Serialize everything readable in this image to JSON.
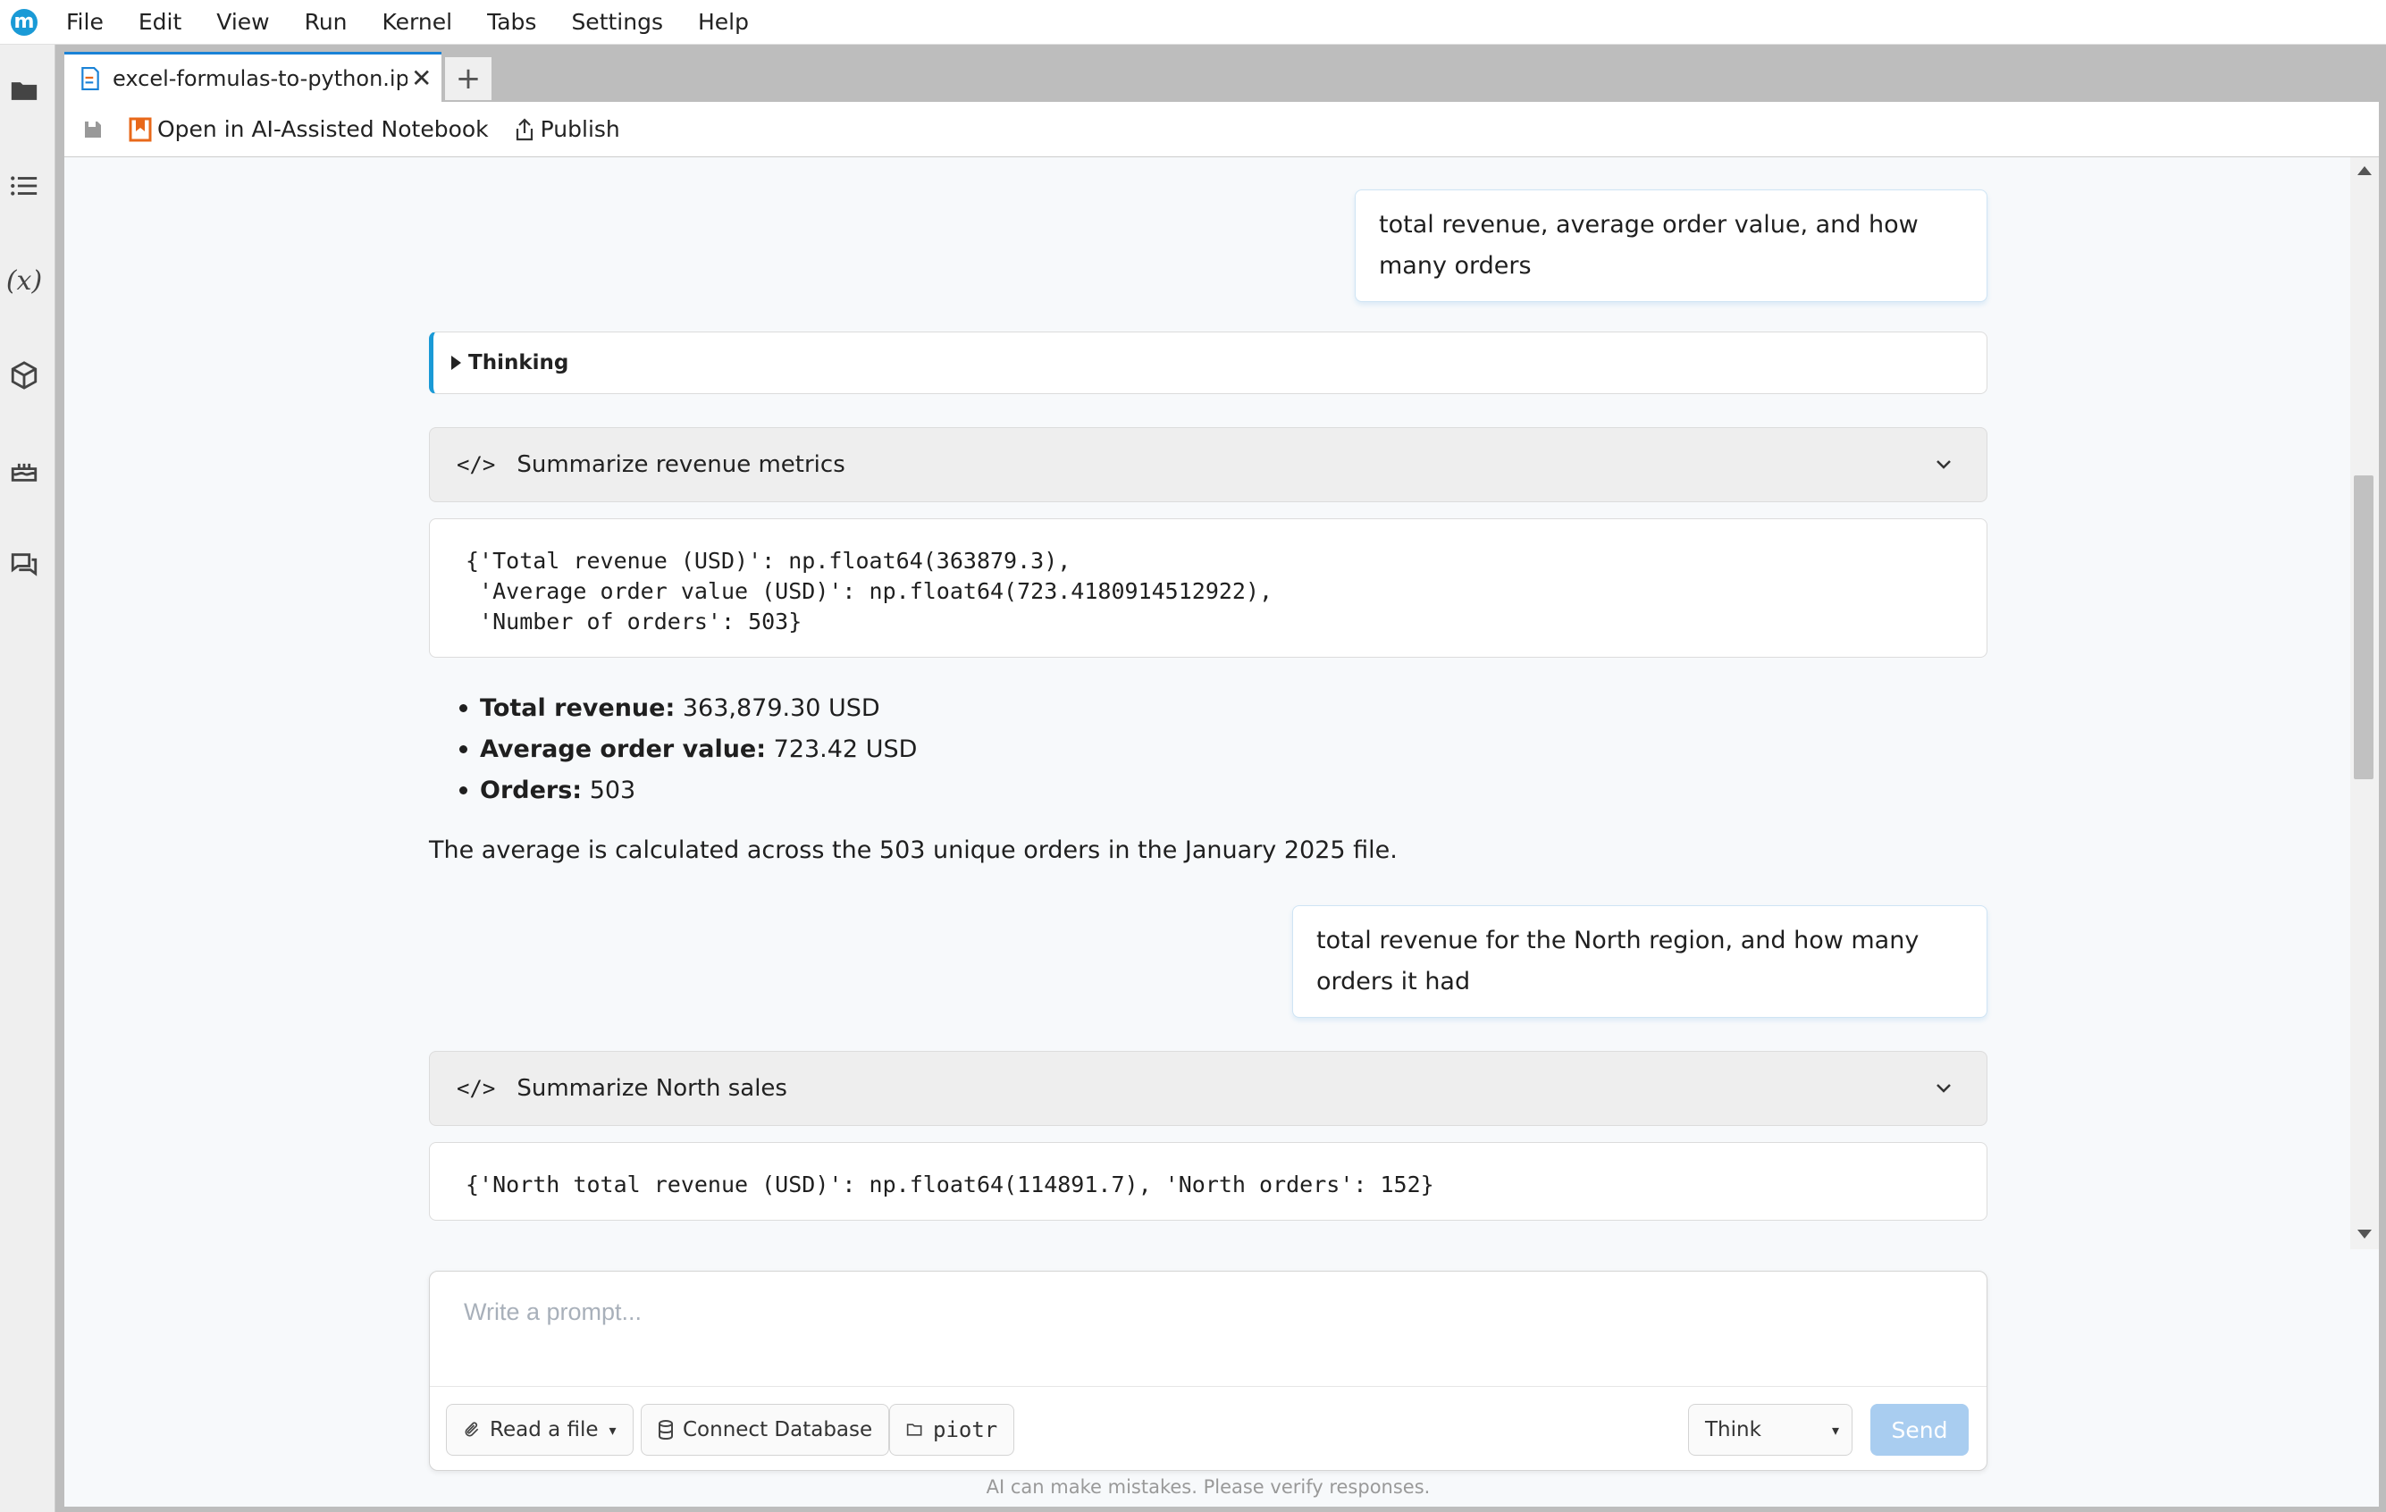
{
  "app": {
    "logo_letter": "m"
  },
  "menubar": {
    "items": [
      "File",
      "Edit",
      "View",
      "Run",
      "Kernel",
      "Tabs",
      "Settings",
      "Help"
    ]
  },
  "sidebar": {
    "icons": [
      "folder-icon",
      "list-icon",
      "variables-icon",
      "package-icon",
      "cake-icon",
      "chat-icon"
    ],
    "variables_label": "(x)"
  },
  "tabs": [
    {
      "label": "excel-formulas-to-python.ipynb",
      "active": true
    }
  ],
  "tab_add": "+",
  "toolbar": {
    "open_ai_label": "Open in AI-Assisted Notebook",
    "publish_label": "Publish"
  },
  "conversation": {
    "user_message_1": "total revenue, average order value, and how many orders",
    "thinking_label": "Thinking",
    "tool_1_title": "Summarize revenue metrics",
    "tool_1_output": "{'Total revenue (USD)': np.float64(363879.3),\n 'Average order value (USD)': np.float64(723.4180914512922),\n 'Number of orders': 503}",
    "bullets": [
      {
        "label": "Total revenue:",
        "value": "363,879.30 USD"
      },
      {
        "label": "Average order value:",
        "value": "723.42 USD"
      },
      {
        "label": "Orders:",
        "value": "503"
      }
    ],
    "summary_text": "The average is calculated across the 503 unique orders in the January 2025 file.",
    "user_message_2": "total revenue for the North region, and how many orders it had",
    "tool_2_title": "Summarize North sales",
    "tool_2_output": "{'North total revenue (USD)': np.float64(114891.7), 'North orders': 152}"
  },
  "prompt": {
    "placeholder": "Write a prompt...",
    "read_file_label": "Read a file",
    "connect_db_label": "Connect Database",
    "folder_label": "piotr",
    "mode_value": "Think",
    "send_label": "Send",
    "disclaimer": "AI can make mistakes. Please verify responses."
  },
  "colors": {
    "accent": "#1a9ad6",
    "send_disabled": "#a9cdf0",
    "active_tab_border": "#1a82d6",
    "ai_notebook_icon": "#e8681a"
  }
}
